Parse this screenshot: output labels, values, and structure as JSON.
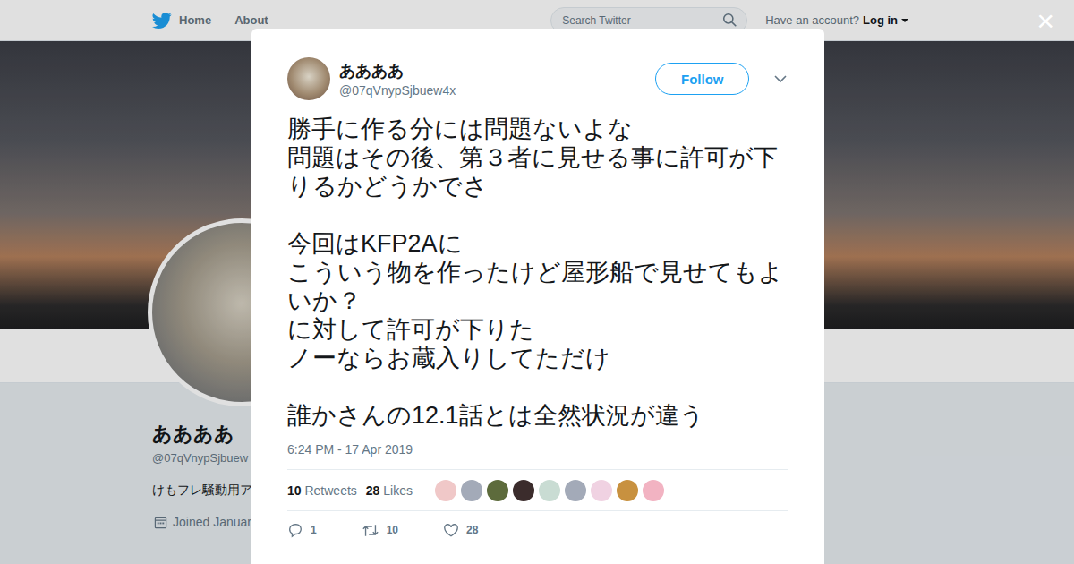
{
  "nav": {
    "home": "Home",
    "about": "About",
    "search_placeholder": "Search Twitter",
    "account_prompt": "Have an account?",
    "login": "Log in"
  },
  "profile": {
    "name": "ああああ",
    "handle": "@07qVnypSjbuew",
    "bio": "けもフレ騒動用ア",
    "joined": "Joined Januar"
  },
  "modal": {
    "close": "×",
    "tweet": {
      "name": "ああああ",
      "handle": "@07qVnypSjbuew4x",
      "follow": "Follow",
      "text": "勝手に作る分には問題ないよな\n問題はその後、第３者に見せる事に許可が下りるかどうかでさ\n\n今回はKFP2Aに\nこういう物を作ったけど屋形船で見せてもよいか？\nに対して許可が下りた\nノーならお蔵入りしてただけ\n\n誰かさんの12.1話とは全然状況が違う",
      "timestamp": "6:24 PM - 17 Apr 2019",
      "stats": {
        "retweets": "10",
        "retweets_label": "Retweets",
        "likes": "28",
        "likes_label": "Likes"
      },
      "liker_avatars": [
        {
          "color": "#f0c8c8"
        },
        {
          "color": "#a3aab8"
        },
        {
          "color": "#5d6b3c"
        },
        {
          "color": "#3b2c2c"
        },
        {
          "color": "#c9dcd3"
        },
        {
          "color": "#a3aab8"
        },
        {
          "color": "#f0d2e2"
        },
        {
          "color": "#c8913f"
        },
        {
          "color": "#f2b3c2"
        }
      ],
      "actions": [
        {
          "kind": "reply",
          "count": "1"
        },
        {
          "kind": "retweet",
          "count": "10"
        },
        {
          "kind": "like",
          "count": "28"
        }
      ]
    }
  }
}
